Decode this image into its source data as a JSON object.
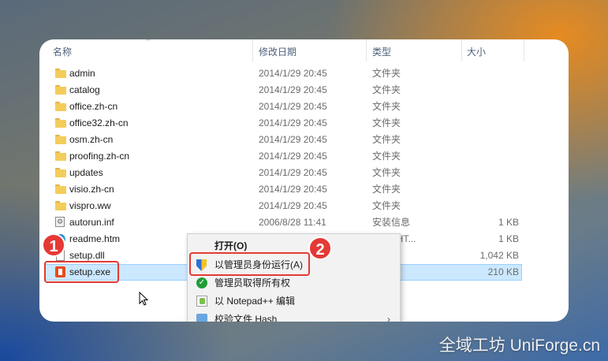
{
  "header": {
    "col_name": "名称",
    "col_date": "修改日期",
    "col_type": "类型",
    "col_size": "大小"
  },
  "files": [
    {
      "name": "admin",
      "date": "2014/1/29 20:45",
      "type": "文件夹",
      "size": "",
      "icon": "folder-icon"
    },
    {
      "name": "catalog",
      "date": "2014/1/29 20:45",
      "type": "文件夹",
      "size": "",
      "icon": "folder-icon"
    },
    {
      "name": "office.zh-cn",
      "date": "2014/1/29 20:45",
      "type": "文件夹",
      "size": "",
      "icon": "folder-icon"
    },
    {
      "name": "office32.zh-cn",
      "date": "2014/1/29 20:45",
      "type": "文件夹",
      "size": "",
      "icon": "folder-icon"
    },
    {
      "name": "osm.zh-cn",
      "date": "2014/1/29 20:45",
      "type": "文件夹",
      "size": "",
      "icon": "folder-icon"
    },
    {
      "name": "proofing.zh-cn",
      "date": "2014/1/29 20:45",
      "type": "文件夹",
      "size": "",
      "icon": "folder-icon"
    },
    {
      "name": "updates",
      "date": "2014/1/29 20:45",
      "type": "文件夹",
      "size": "",
      "icon": "folder-icon"
    },
    {
      "name": "visio.zh-cn",
      "date": "2014/1/29 20:45",
      "type": "文件夹",
      "size": "",
      "icon": "folder-icon"
    },
    {
      "name": "vispro.ww",
      "date": "2014/1/29 20:45",
      "type": "文件夹",
      "size": "",
      "icon": "folder-icon"
    },
    {
      "name": "autorun.inf",
      "date": "2006/8/28 11:41",
      "type": "安装信息",
      "size": "1 KB",
      "icon": "settings-file-icon"
    },
    {
      "name": "readme.htm",
      "date": "",
      "type": "rome HT...",
      "size": "1 KB",
      "icon": "edge-icon"
    },
    {
      "name": "setup.dll",
      "date": "",
      "type": "序扩展",
      "size": "1,042 KB",
      "icon": "dll-file-icon"
    },
    {
      "name": "setup.exe",
      "date": "",
      "type": "序",
      "size": "210 KB",
      "icon": "office-icon"
    }
  ],
  "context_menu": {
    "open": "打开(O)",
    "run_as_admin": "以管理员身份运行(A)",
    "take_ownership": "管理员取得所有权",
    "notepadpp": "以 Notepad++ 编辑",
    "hash": "校验文件 Hash"
  },
  "badges": {
    "one": "1",
    "two": "2"
  },
  "watermark": "全域工坊 UniForge.cn",
  "colors": {
    "selection": "#cce8ff",
    "callout_red": "#e53935",
    "folder": "#f4cc5b"
  }
}
